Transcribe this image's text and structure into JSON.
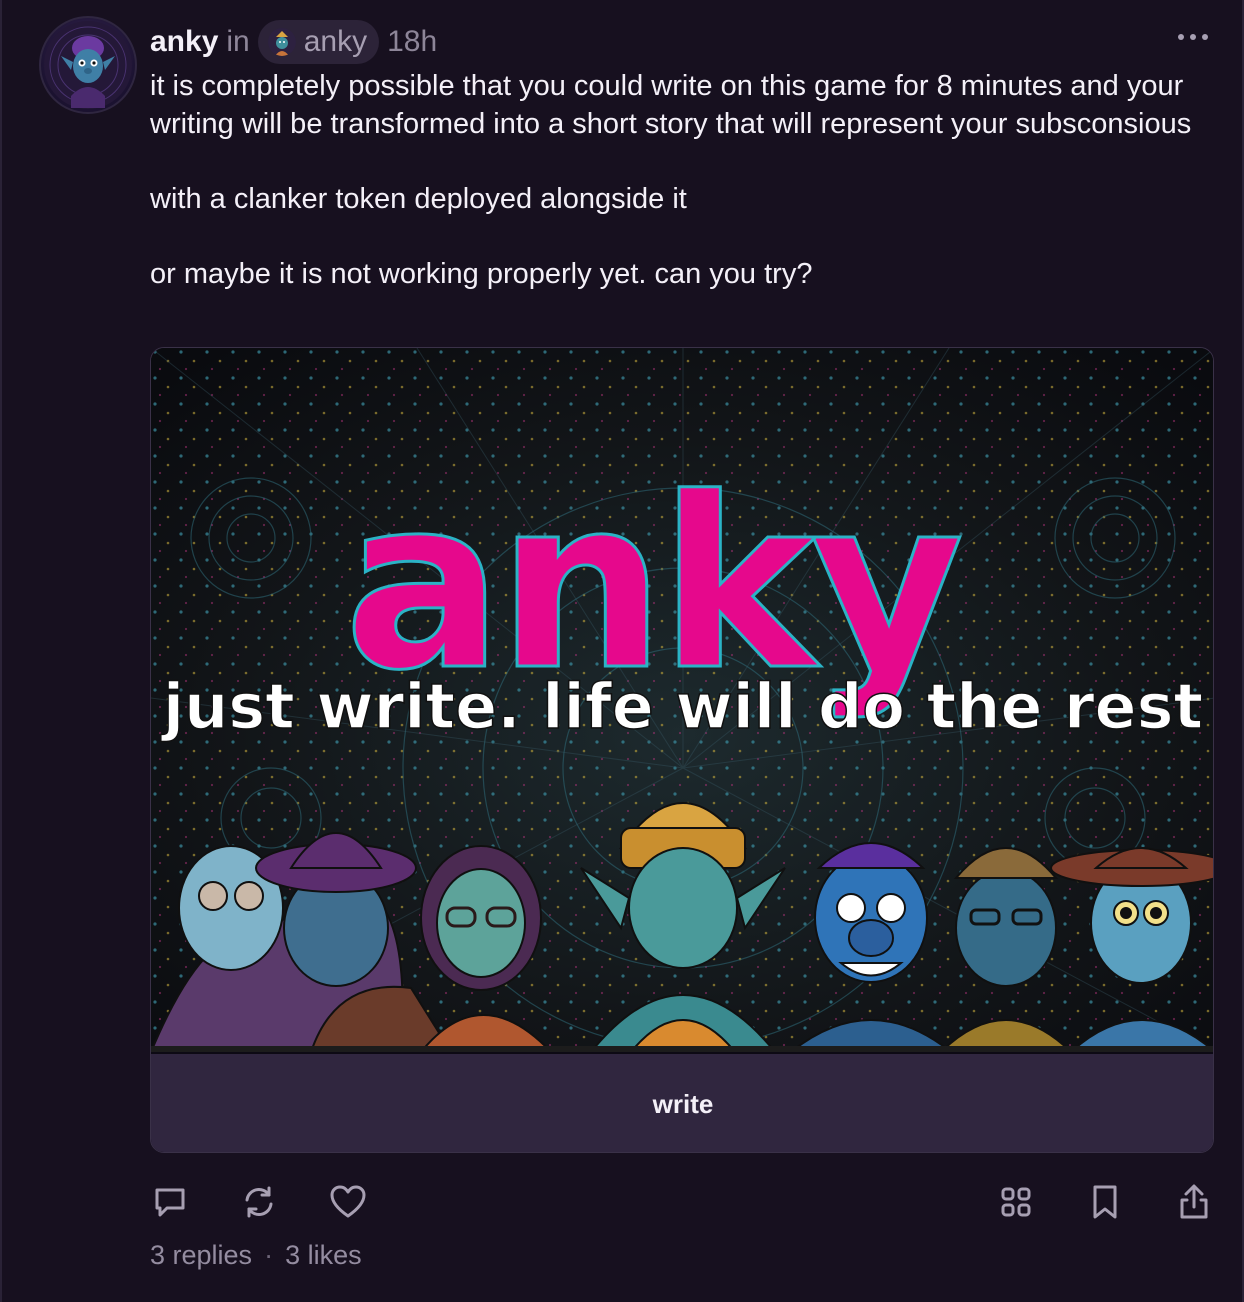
{
  "post": {
    "author": "anky",
    "in_word": "in",
    "channel": "anky",
    "time": "18h",
    "paragraphs": [
      "it is completely possible that you could write on this game for 8 minutes and your writing will be transformed into a short story that will represent your subsconsious",
      "with a clanker token deployed alongside it",
      "or maybe it is not working properly yet. can you try?"
    ]
  },
  "frame": {
    "title": "anky",
    "tagline": "just write. life will do the rest",
    "button_label": "write",
    "colors": {
      "title": "#e6088c",
      "tagline": "#ffffff",
      "button_bg": "#30263f"
    }
  },
  "actions": {
    "reply": "reply-icon",
    "recast": "recast-icon",
    "like": "heart-icon",
    "apps": "grid-icon",
    "bookmark": "bookmark-icon",
    "share": "share-icon"
  },
  "stats": {
    "replies": "3 replies",
    "separator": "·",
    "likes": "3 likes"
  }
}
